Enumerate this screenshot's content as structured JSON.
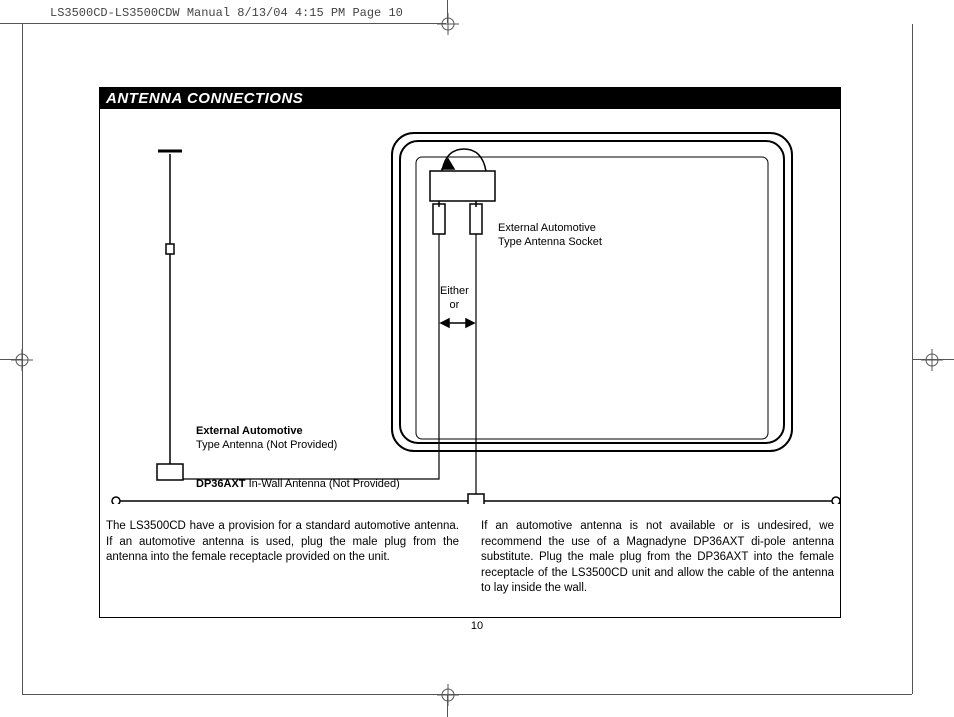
{
  "header": "LS3500CD-LS3500CDW Manual  8/13/04  4:15 PM  Page 10",
  "title": "ANTENNA CONNECTIONS",
  "labels": {
    "socket": "External Automotive\nType Antenna Socket",
    "either_or": "Either\nor",
    "ext_auto_title": "External Automotive",
    "ext_auto_sub": "Type Antenna (Not Provided)",
    "dp_title": "DP36AXT",
    "dp_sub": " In-Wall Antenna (Not Provided)"
  },
  "body": {
    "left": "The LS3500CD have a provision for a standard automotive antenna. If an automotive antenna is used, plug the male plug from the antenna into the female receptacle provided on the unit.",
    "right": "If an automotive antenna is not available or is undesired, we recommend the use of a Magnadyne DP36AXT di-pole antenna substitute. Plug the male plug from the DP36AXT into the female receptacle of the LS3500CD unit and allow the cable of the antenna to lay inside the wall."
  },
  "page_number": "10"
}
